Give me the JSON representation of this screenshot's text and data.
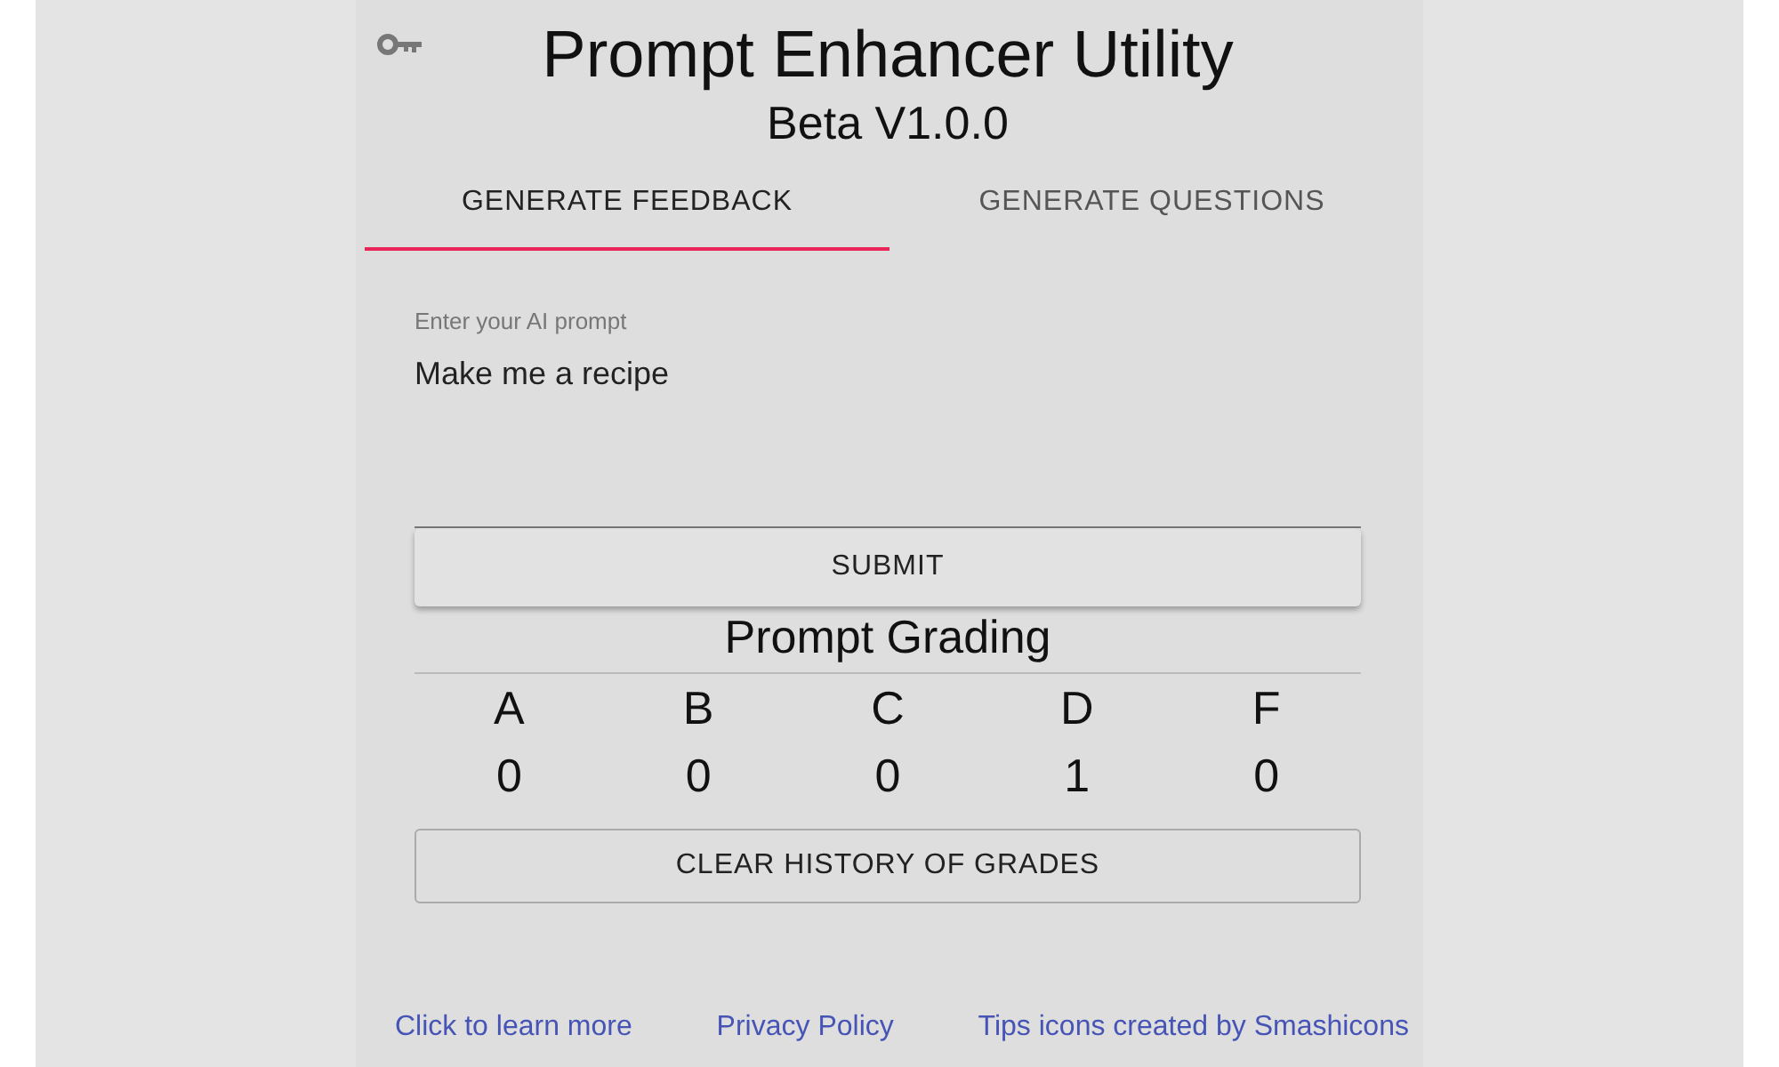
{
  "header": {
    "title": "Prompt Enhancer Utility",
    "subtitle": "Beta V1.0.0"
  },
  "tabs": [
    {
      "label": "GENERATE FEEDBACK",
      "selected": true
    },
    {
      "label": "GENERATE QUESTIONS",
      "selected": false
    }
  ],
  "prompt_field": {
    "label": "Enter your AI prompt",
    "value": "Make me a recipe"
  },
  "submit_button": "SUBMIT",
  "grading": {
    "title": "Prompt Grading",
    "grades": [
      {
        "letter": "A",
        "count": "0"
      },
      {
        "letter": "B",
        "count": "0"
      },
      {
        "letter": "C",
        "count": "0"
      },
      {
        "letter": "D",
        "count": "1"
      },
      {
        "letter": "F",
        "count": "0"
      }
    ]
  },
  "clear_button": "CLEAR HISTORY OF GRADES",
  "footer_links": [
    "Click to learn more",
    "Privacy Policy",
    "Tips icons created by Smashicons"
  ]
}
